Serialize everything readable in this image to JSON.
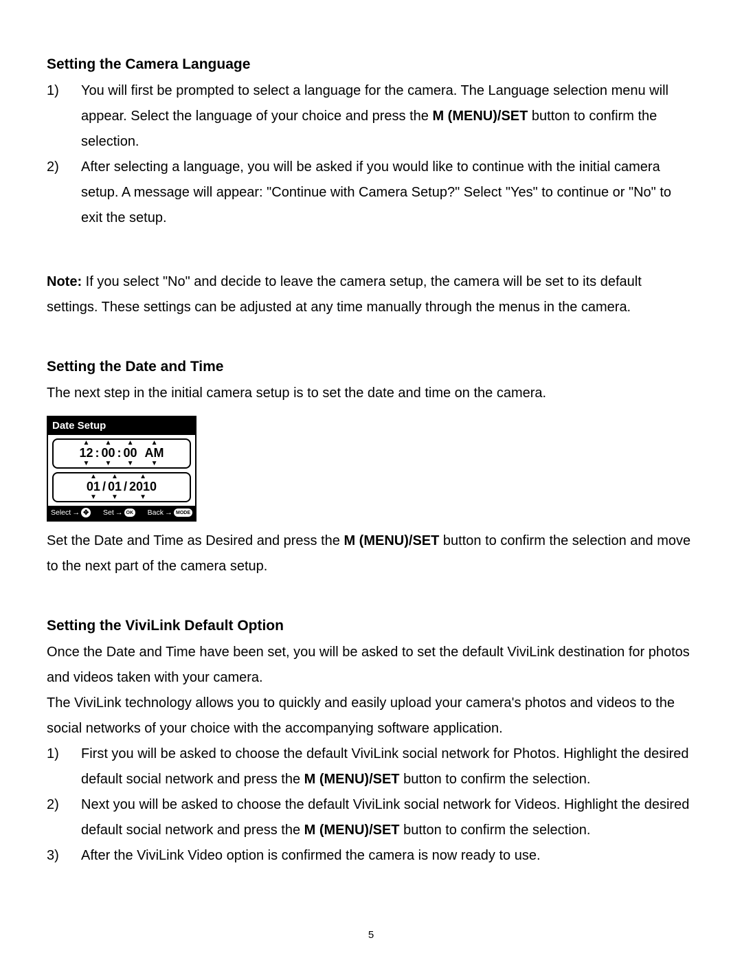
{
  "section1": {
    "heading": "Setting the Camera Language",
    "items": [
      {
        "num": "1)",
        "pre": "You will first be prompted to select a language for the camera. The Language selection menu will appear. Select the language of your choice and press the ",
        "bold": "M (MENU)/SET",
        "post": " button to confirm the selection."
      },
      {
        "num": "2)",
        "text": "After selecting a language, you will be asked if you would like to continue with the initial camera setup. A message will appear: \"Continue with Camera Setup?\" Select \"Yes\" to continue or \"No\" to exit the setup."
      }
    ],
    "note_label": "Note:",
    "note_text": " If you select \"No\" and decide to leave the camera setup, the camera will be set to its default settings. These settings can be adjusted at any time manually through the menus in the camera."
  },
  "section2": {
    "heading": "Setting the Date and Time",
    "intro": "The next step in the initial camera setup is to set the date and time on the camera.",
    "widget": {
      "title": "Date Setup",
      "time": {
        "h": "12",
        "m": "00",
        "s": "00",
        "ampm": "AM"
      },
      "date": {
        "mo": "01",
        "d": "01",
        "y": "2010"
      },
      "footer": {
        "select": "Select",
        "set": "Set",
        "back": "Back",
        "ok": "OK",
        "mode": "MODE"
      }
    },
    "para_pre": "Set the Date and Time as Desired and press the ",
    "para_bold": "M (MENU)/SET",
    "para_post": " button to confirm the selection and move to the next part of the camera setup."
  },
  "section3": {
    "heading": "Setting the ViviLink Default Option",
    "p1": "Once the Date and Time have been set, you will be asked to set the default ViviLink destination for photos and videos taken with your camera.",
    "p2": "The ViviLink technology allows you to quickly and easily upload your camera's photos and videos to the social networks of your choice with the accompanying software application.",
    "items": [
      {
        "num": "1)",
        "pre": "First you will be asked to choose the default ViviLink social network for Photos. Highlight the desired default social network and press the ",
        "bold": "M (MENU)/SET",
        "post": " button to confirm the selection."
      },
      {
        "num": "2)",
        "pre": "Next you will be asked to choose the default ViviLink social network for Videos. Highlight the desired default social network and press the ",
        "bold": "M (MENU)/SET",
        "post": " button to confirm the selection."
      },
      {
        "num": "3)",
        "text": "After the ViviLink Video option is confirmed the camera is now ready to use."
      }
    ]
  },
  "page_number": "5"
}
